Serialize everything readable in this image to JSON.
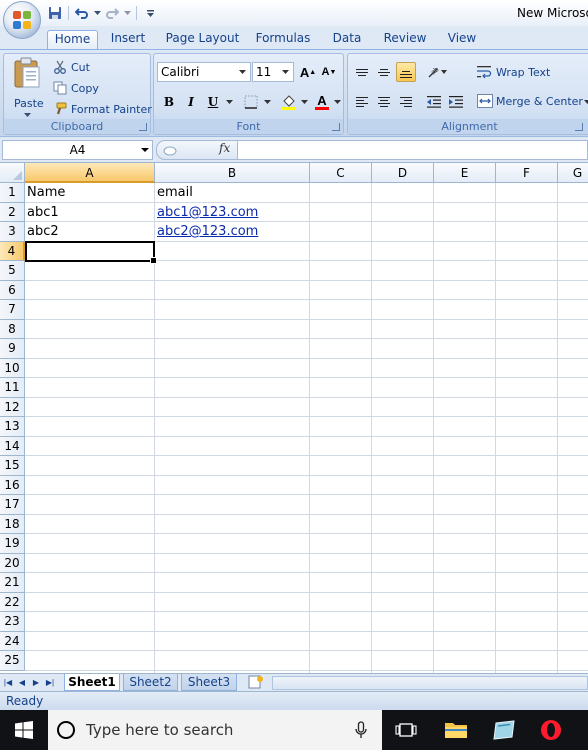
{
  "window": {
    "title": "New Microsof"
  },
  "tabs": [
    {
      "label": "Home",
      "active": true
    },
    {
      "label": "Insert"
    },
    {
      "label": "Page Layout"
    },
    {
      "label": "Formulas"
    },
    {
      "label": "Data"
    },
    {
      "label": "Review"
    },
    {
      "label": "View"
    }
  ],
  "ribbon": {
    "clipboard": {
      "label": "Clipboard",
      "paste": "Paste",
      "cut": "Cut",
      "copy": "Copy",
      "format_painter": "Format Painter"
    },
    "font": {
      "label": "Font",
      "font_name": "Calibri",
      "font_size": "11",
      "grow": "A",
      "shrink": "A",
      "bold": "B",
      "italic": "I",
      "underline": "U",
      "font_color": "A"
    },
    "alignment": {
      "label": "Alignment",
      "wrap_text": "Wrap Text",
      "merge_center": "Merge & Center"
    }
  },
  "formula_bar": {
    "name_box": "A4",
    "fx": "fx",
    "value": ""
  },
  "sheet": {
    "columns": [
      "A",
      "B",
      "C",
      "D",
      "E",
      "F",
      "G"
    ],
    "active_column": "A",
    "active_row": 4,
    "rows": [
      "1",
      "2",
      "3",
      "4",
      "5",
      "6",
      "7",
      "8",
      "9",
      "10",
      "11",
      "12",
      "13",
      "14",
      "15",
      "16",
      "17",
      "18",
      "19",
      "20",
      "21",
      "22",
      "23",
      "24",
      "25"
    ],
    "cells": {
      "A1": "Name",
      "B1": "email",
      "A2": "abc1",
      "B2": "abc1@123.com",
      "A3": "abc2",
      "B3": "abc2@123.com"
    }
  },
  "sheet_tabs": [
    {
      "label": "Sheet1",
      "active": true
    },
    {
      "label": "Sheet2"
    },
    {
      "label": "Sheet3"
    }
  ],
  "status": {
    "text": "Ready"
  },
  "taskbar": {
    "search_placeholder": "Type here to search"
  },
  "colors": {
    "accent": "#15428b",
    "ribbon": "#dfe8f5",
    "link": "#0b2bad",
    "active_header": "#f8c86b"
  }
}
